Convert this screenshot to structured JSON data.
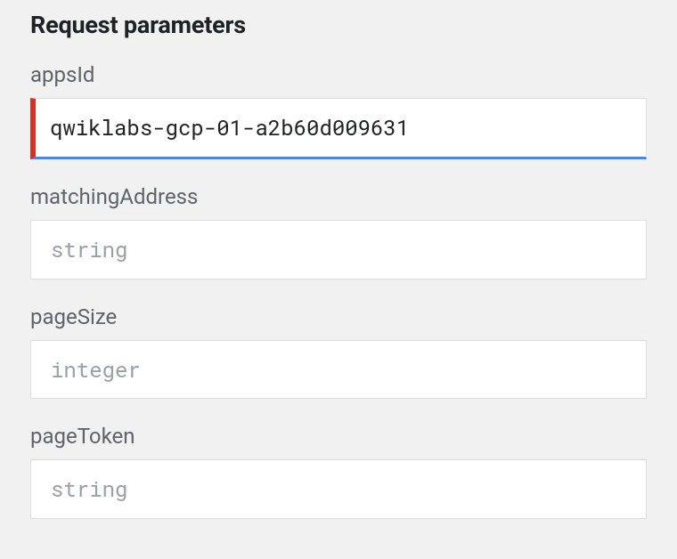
{
  "section_title": "Request parameters",
  "params": {
    "appsId": {
      "label": "appsId",
      "value": "qwiklabs-gcp-01-a2b60d009631",
      "placeholder": ""
    },
    "matchingAddress": {
      "label": "matchingAddress",
      "value": "",
      "placeholder": "string"
    },
    "pageSize": {
      "label": "pageSize",
      "value": "",
      "placeholder": "integer"
    },
    "pageToken": {
      "label": "pageToken",
      "value": "",
      "placeholder": "string"
    }
  }
}
